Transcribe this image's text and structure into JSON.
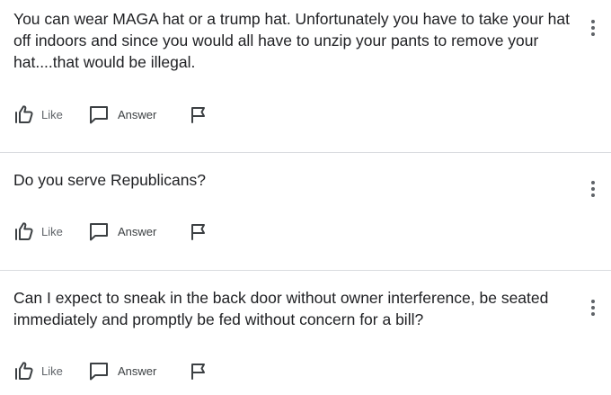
{
  "questions": [
    {
      "text": "You can wear MAGA hat or a trump hat. Unfortunately you have to take your hat off indoors and since you would all have to unzip your pants to remove your hat....that would be illegal.",
      "actions": {
        "like_label": "Like",
        "answer_label": "Answer"
      }
    },
    {
      "text": "Do you serve Republicans?",
      "actions": {
        "like_label": "Like",
        "answer_label": "Answer"
      }
    },
    {
      "text": "Can I expect to sneak in the back door without owner interference, be seated immediately and promptly be fed without concern for a bill?",
      "actions": {
        "like_label": "Like",
        "answer_label": "Answer"
      }
    }
  ],
  "icons": {
    "more": "more-vert-icon",
    "like": "thumb-up-icon",
    "answer": "comment-icon",
    "flag": "flag-icon"
  },
  "colors": {
    "text": "#202124",
    "icon": "#5f6368",
    "divider": "#dadce0"
  }
}
